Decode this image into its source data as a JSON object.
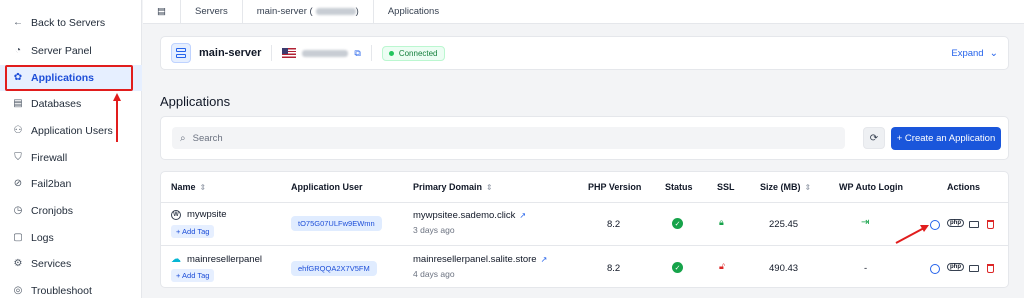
{
  "sidebar": {
    "items": [
      {
        "label": "Back to Servers",
        "icon": "arrow-left-icon"
      },
      {
        "label": "Server Panel",
        "icon": "gauge-icon"
      },
      {
        "label": "Applications",
        "icon": "apps-icon",
        "active": true
      },
      {
        "label": "Databases",
        "icon": "database-icon"
      },
      {
        "label": "Application Users",
        "icon": "users-icon"
      },
      {
        "label": "Firewall",
        "icon": "shield-icon"
      },
      {
        "label": "Fail2ban",
        "icon": "ban-icon"
      },
      {
        "label": "Cronjobs",
        "icon": "clock-icon"
      },
      {
        "label": "Logs",
        "icon": "file-icon"
      },
      {
        "label": "Services",
        "icon": "services-icon"
      },
      {
        "label": "Troubleshoot",
        "icon": "help-icon"
      }
    ]
  },
  "breadcrumb": {
    "items": [
      "Servers",
      "main-server (",
      "Applications"
    ],
    "close": ")"
  },
  "server": {
    "name": "main-server",
    "status": "Connected",
    "expand_label": "Expand"
  },
  "page": {
    "title": "Applications"
  },
  "search": {
    "placeholder": "Search",
    "create_label": "+ Create an Application"
  },
  "table": {
    "headers": {
      "name": "Name",
      "user": "Application User",
      "domain": "Primary Domain",
      "php": "PHP Version",
      "status": "Status",
      "ssl": "SSL",
      "size": "Size (MB)",
      "wp_login": "WP Auto Login",
      "actions": "Actions"
    },
    "add_tag_label": "+ Add Tag",
    "rows": [
      {
        "name": "mywpsite",
        "app_type_icon": "wordpress-icon",
        "user": "tO75G07ULFw9EWmn",
        "domain": "mywpsitee.sademo.click",
        "time": "3 days ago",
        "php": "8.2",
        "status": "ok",
        "ssl": "enabled",
        "size": "225.45",
        "wp_login": "login-icon"
      },
      {
        "name": "mainresellerpanel",
        "app_type_icon": "cloud-icon",
        "user": "ehfGRQQA2X7V5FM",
        "domain": "mainresellerpanel.salite.store",
        "time": "4 days ago",
        "php": "8.2",
        "status": "ok",
        "ssl": "disabled",
        "size": "490.43",
        "wp_login": "-"
      }
    ]
  },
  "colors": {
    "accent": "#1a56db",
    "annotation": "#e11d1d",
    "success": "#16a34a",
    "danger": "#dc2626"
  }
}
